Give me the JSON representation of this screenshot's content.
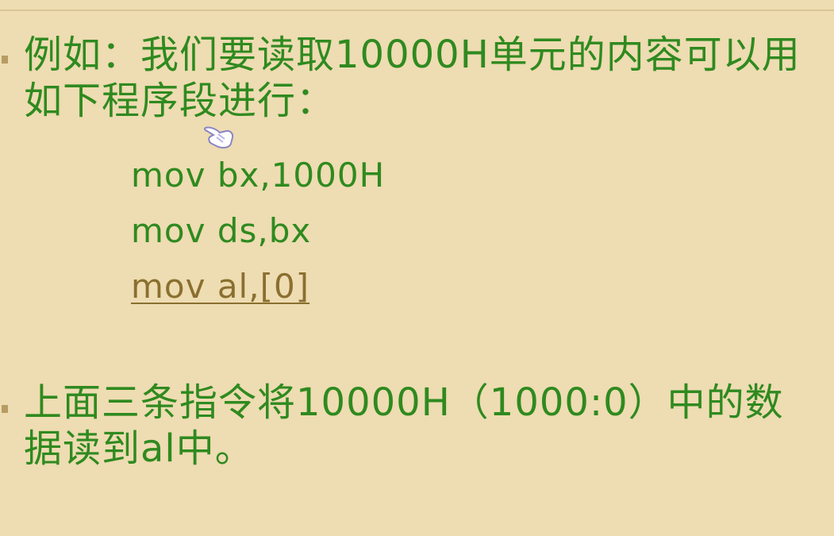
{
  "paragraph1": "例如：我们要读取10000H单元的内容可以用如下程序段进行：",
  "code": [
    "mov bx,1000H",
    "mov ds,bx",
    "mov al,[0]"
  ],
  "paragraph2": "上面三条指令将10000H（1000:0）中的数据读到al中。",
  "colors": {
    "background": "#eedcb2",
    "text": "#2f8a1f",
    "highlight": "#8a6f2f",
    "bullet": "#b79c62"
  },
  "icons": {
    "pointer": "hand-pointer-icon"
  }
}
